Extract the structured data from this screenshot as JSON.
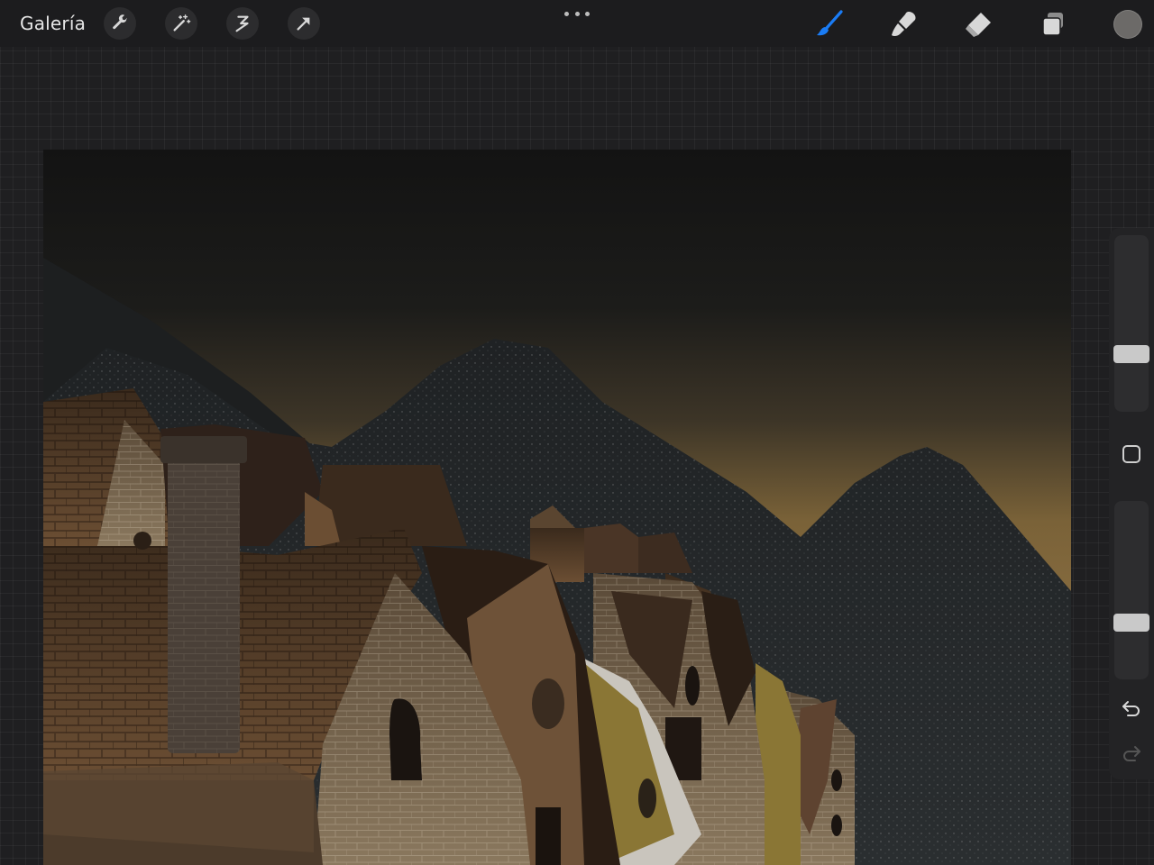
{
  "app": {
    "gallery_label": "Galería"
  },
  "toolbar": {
    "left_tools": [
      {
        "name": "actions",
        "icon": "wrench-icon"
      },
      {
        "name": "adjustments",
        "icon": "magic-wand-icon"
      },
      {
        "name": "selection",
        "icon": "selection-s-icon"
      },
      {
        "name": "transform",
        "icon": "arrow-icon"
      }
    ],
    "more_icon": "more-dots-icon",
    "right_tools": [
      {
        "name": "brush",
        "icon": "brush-icon",
        "active": true,
        "color": "#1a7cf5"
      },
      {
        "name": "smudge",
        "icon": "smudge-icon",
        "active": false
      },
      {
        "name": "eraser",
        "icon": "eraser-icon",
        "active": false
      },
      {
        "name": "layers",
        "icon": "layers-icon",
        "active": false
      }
    ],
    "current_color": "#6c6a68"
  },
  "sidebar": {
    "brush_size_level": 0.4,
    "opacity_level": 0.33,
    "modify_icon": "square-icon",
    "undo_icon": "undo-icon",
    "redo_icon": "redo-icon"
  },
  "artwork": {
    "description_colors": {
      "sky_top": "#141414",
      "sky_glow": "#7a6238",
      "mountain": "#24282a",
      "roof": "#6b4e33",
      "brick": "#8a785e",
      "yellow_house": "#8a7635"
    }
  }
}
